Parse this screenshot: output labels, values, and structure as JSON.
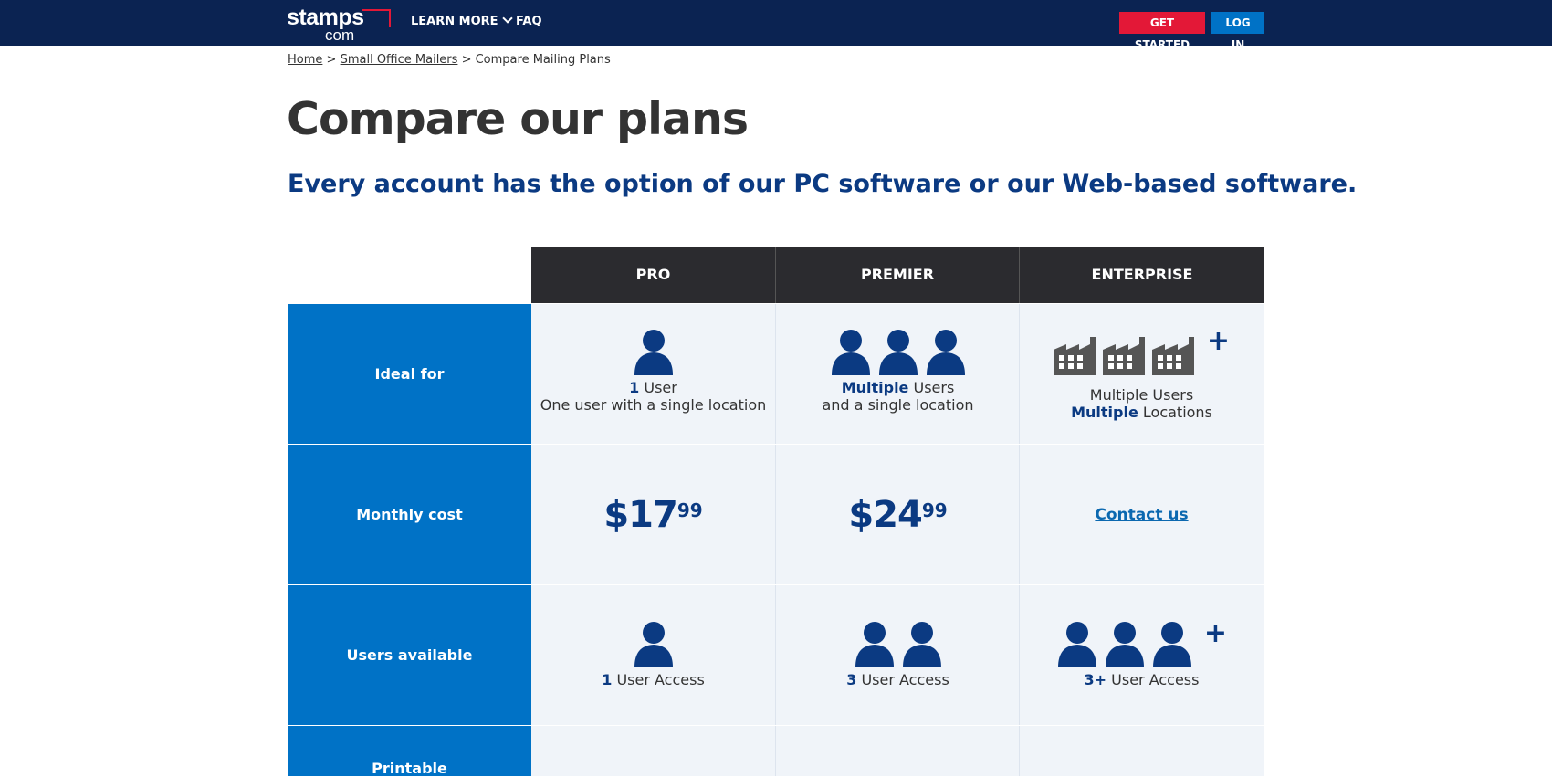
{
  "header": {
    "logo_main": "stamps",
    "logo_sub": "com",
    "nav": [
      {
        "label": "LEARN MORE",
        "has_dropdown": true
      },
      {
        "label": "FAQ",
        "has_dropdown": false
      }
    ],
    "get_started_label": "GET STARTED",
    "login_label": "LOG IN"
  },
  "breadcrumb": {
    "home": "Home",
    "section": "Small Office Mailers",
    "current": "Compare Mailing Plans",
    "sep": ">"
  },
  "page": {
    "title": "Compare our plans",
    "subtitle": "Every account has the option of our PC software or our Web-based software."
  },
  "plans": [
    {
      "name": "PRO"
    },
    {
      "name": "PREMIER"
    },
    {
      "name": "ENTERPRISE"
    }
  ],
  "rows": {
    "ideal_for": {
      "label": "Ideal for",
      "pro": {
        "strong": "1",
        "line1_rest": " User",
        "line2": "One user with a single location"
      },
      "premier": {
        "strong": "Multiple",
        "line1_rest": " Users",
        "line2": "and a single location"
      },
      "enterprise": {
        "line1": "Multiple Users",
        "strong": "Multiple",
        "line2_rest": " Locations",
        "plus": "+"
      }
    },
    "monthly_cost": {
      "label": "Monthly cost",
      "pro": {
        "dollars": "$17",
        "cents": "99"
      },
      "premier": {
        "dollars": "$24",
        "cents": "99"
      },
      "enterprise": {
        "link": "Contact us"
      }
    },
    "users_available": {
      "label": "Users available",
      "pro": {
        "strong": "1",
        "rest": " User Access"
      },
      "premier": {
        "strong": "3",
        "rest": " User Access"
      },
      "enterprise": {
        "strong": "3+",
        "rest": " User Access",
        "plus": "+"
      }
    },
    "printable": {
      "label": "Printable"
    }
  },
  "colors": {
    "navy": "#0b2352",
    "accent_blue": "#0072c6",
    "red": "#e31837",
    "icon_navy": "#0b3a82",
    "building_gray": "#555555"
  },
  "icons": {
    "person": "person-icon",
    "building": "building-icon"
  }
}
